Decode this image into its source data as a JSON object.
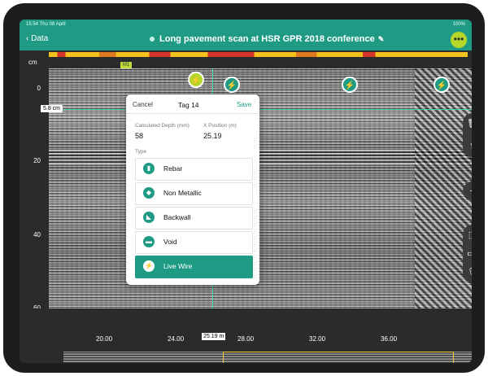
{
  "status": {
    "time_date": "15:54 Thu 08 April",
    "battery": "100%"
  },
  "nav": {
    "back_label": "Data",
    "title": "Long pavement scan at HSR GPR 2018 conference",
    "menu_glyph": "•••"
  },
  "scan": {
    "depth_unit": "cm",
    "depth_marker": "5.8 cm",
    "marker_label": "M1",
    "y_ticks": [
      "0",
      "20",
      "40",
      "60"
    ],
    "x_ticks": [
      "20.00",
      "24.00",
      "28.00",
      "32.00",
      "36.00"
    ],
    "x_unit": "m",
    "position_readout": "25.19 m"
  },
  "tags": [
    {
      "name": "tag-pin-active",
      "icon": "bolt-icon",
      "glyph": "⚡"
    },
    {
      "name": "tag-pin",
      "icon": "bolt-icon",
      "glyph": "⚡"
    },
    {
      "name": "tag-pin",
      "icon": "bolt-icon",
      "glyph": "⚡"
    },
    {
      "name": "tag-pin",
      "icon": "bolt-icon",
      "glyph": "⚡"
    }
  ],
  "tools": {
    "trash": "🗑",
    "share": "⇪",
    "add": "+",
    "select": "⬚",
    "split": "⊏⊐",
    "mic": "🎙"
  },
  "popup": {
    "cancel": "Cancel",
    "title": "Tag 14",
    "save": "Save",
    "depth_label": "Calculated Depth (mm)",
    "depth_value": "58",
    "xpos_label": "X Position (m)",
    "xpos_value": "25.19",
    "type_label": "Type",
    "types": [
      {
        "label": "Rebar",
        "icon": "rebar-icon",
        "glyph": "▮"
      },
      {
        "label": "Non Metallic",
        "icon": "non-metallic-icon",
        "glyph": "◆"
      },
      {
        "label": "Backwall",
        "icon": "backwall-icon",
        "glyph": "◣"
      },
      {
        "label": "Void",
        "icon": "void-icon",
        "glyph": "▬"
      },
      {
        "label": "Live Wire",
        "icon": "live-wire-icon",
        "glyph": "⚡"
      }
    ],
    "selected_type": "Live Wire"
  },
  "colors": {
    "accent": "#1f9b85",
    "highlight": "#b6d72a",
    "overview_frame": "#f2d03c"
  }
}
